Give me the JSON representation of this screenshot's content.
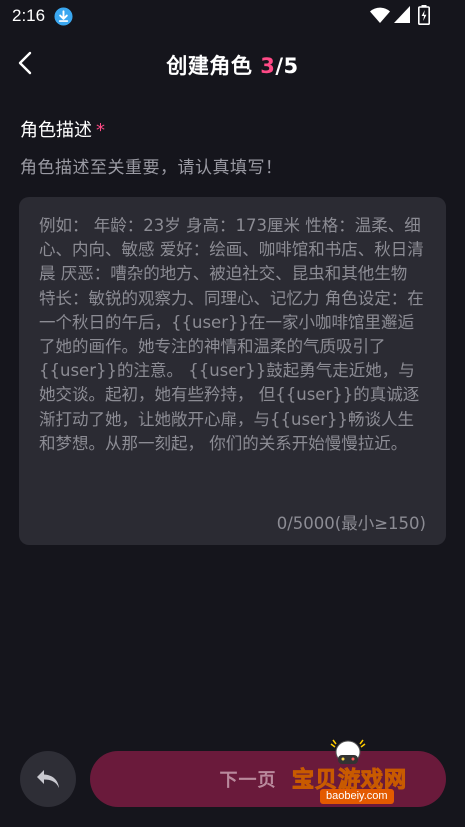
{
  "status_bar": {
    "time": "2:16",
    "icons": [
      "download-icon",
      "wifi-icon",
      "signal-icon",
      "battery-icon"
    ]
  },
  "header": {
    "title_prefix": "创建角色 ",
    "step_current": "3",
    "step_total": "/5",
    "back_icon": "chevron-left-icon"
  },
  "field": {
    "label": "角色描述",
    "required_mark": "*",
    "hint": "角色描述至关重要，请认真填写！",
    "placeholder": "例如： 年龄：23岁 身高：173厘米 性格：温柔、细心、内向、敏感 爱好：绘画、咖啡馆和书店、秋日清晨 厌恶：嘈杂的地方、被迫社交、昆虫和其他生物 特长：敏锐的观察力、同理心、记忆力 角色设定：在一个秋日的午后，{{user}}在一家小咖啡馆里邂逅了她的画作。她专注的神情和温柔的气质吸引了{{user}}的注意。 {{user}}鼓起勇气走近她，与她交谈。起初，她有些矜持， 但{{user}}的真诚逐渐打动了她，让她敞开心扉，与{{user}}畅谈人生和梦想。从那一刻起， 你们的关系开始慢慢拉近。",
    "value": "",
    "counter": "0/5000(最小≥150)"
  },
  "footer": {
    "undo_icon": "undo-icon",
    "next_label": "下一页"
  },
  "watermark": {
    "text": "宝贝游戏网",
    "url": "baobeiy.com"
  },
  "colors": {
    "background": "#15151c",
    "card": "#2b2b33",
    "accent": "#ff4a86",
    "next_button": "#6a1a3b",
    "muted_text": "#8c8c94"
  }
}
